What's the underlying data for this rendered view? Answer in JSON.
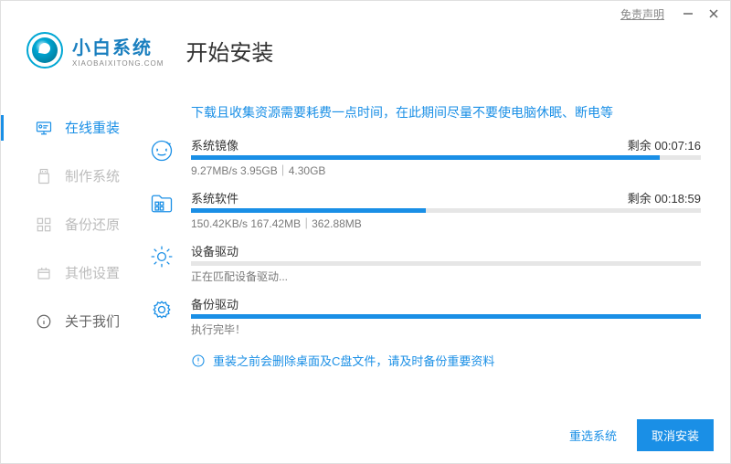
{
  "titlebar": {
    "disclaimer": "免责声明"
  },
  "brand": {
    "name_cn": "小白系统",
    "name_en": "XIAOBAIXITONG.COM"
  },
  "page_title": "开始安装",
  "sidebar": {
    "items": [
      {
        "label": "在线重装"
      },
      {
        "label": "制作系统"
      },
      {
        "label": "备份还原"
      },
      {
        "label": "其他设置"
      },
      {
        "label": "关于我们"
      }
    ]
  },
  "main": {
    "warning": "下载且收集资源需要耗费一点时间，在此期间尽量不要使电脑休眠、断电等",
    "tasks": [
      {
        "title": "系统镜像",
        "remain": "剩余 00:07:16",
        "detail": "9.27MB/s 3.95GB｜4.30GB",
        "pct": 92
      },
      {
        "title": "系统软件",
        "remain": "剩余 00:18:59",
        "detail": "150.42KB/s 167.42MB｜362.88MB",
        "pct": 46
      },
      {
        "title": "设备驱动",
        "remain": "",
        "detail": "正在匹配设备驱动...",
        "pct": 0
      },
      {
        "title": "备份驱动",
        "remain": "",
        "detail": "执行完毕！",
        "pct": 100
      }
    ],
    "notice": "重装之前会删除桌面及C盘文件，请及时备份重要资料"
  },
  "footer": {
    "reselect": "重选系统",
    "cancel": "取消安装"
  }
}
